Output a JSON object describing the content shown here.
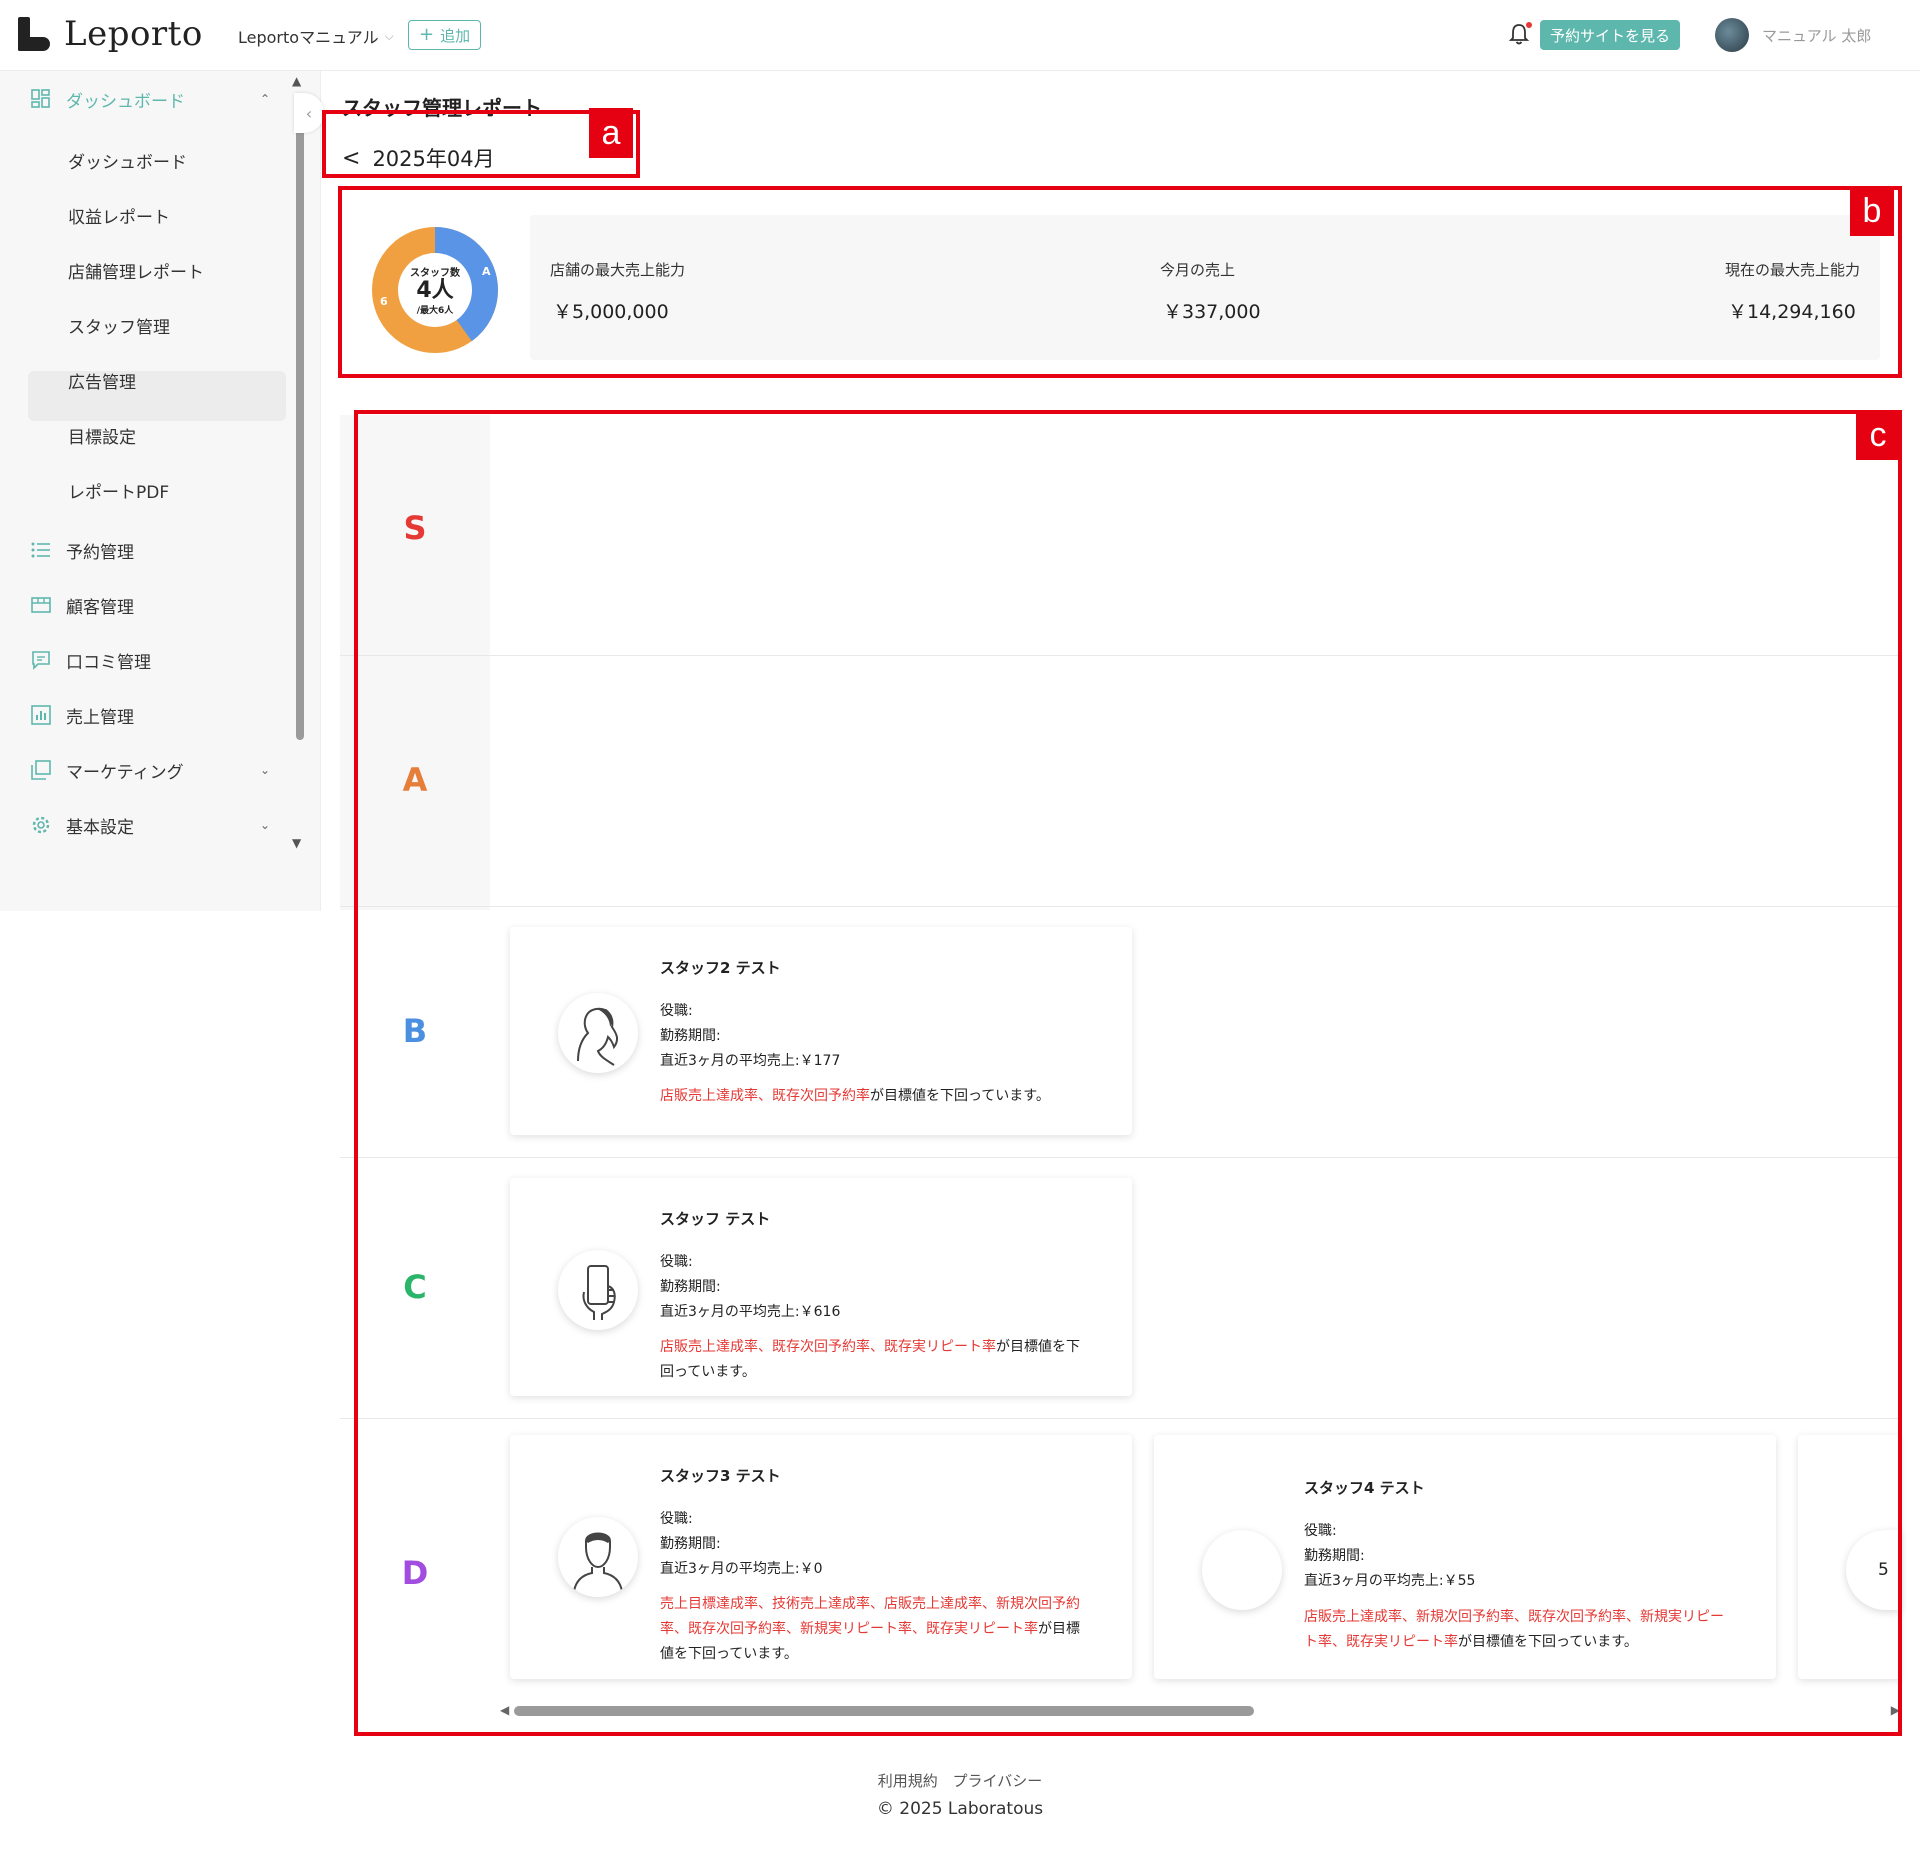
{
  "header": {
    "logo_text": "Leporto",
    "shop_name": "Leportoマニュアル",
    "add_label": "追加",
    "site_button": "予約サイトを見る",
    "user_name": "マニュアル 太郎"
  },
  "sidebar": {
    "dashboard": "ダッシュボード",
    "sub_items": [
      "ダッシュボード",
      "収益レポート",
      "店舗管理レポート",
      "スタッフ管理",
      "広告管理",
      "目標設定",
      "レポートPDF"
    ],
    "items": [
      "予約管理",
      "顧客管理",
      "口コミ管理",
      "売上管理",
      "マーケティング",
      "基本設定"
    ]
  },
  "main": {
    "title": "スタッフ管理レポート",
    "month": "2025年04月"
  },
  "summary": {
    "donut": {
      "top_label": "スタッフ数",
      "count": "4人",
      "max_label": "/最大6人",
      "seg_a_label": "A",
      "seg_b_label": "6",
      "filled_fraction": 0.4
    },
    "stats": [
      {
        "label": "店舗の最大売上能力",
        "value": "￥5,000,000"
      },
      {
        "label": "今月の売上",
        "value": "￥337,000"
      },
      {
        "label": "現在の最大売上能力",
        "value": "￥14,294,160"
      }
    ]
  },
  "ranks": {
    "s": "S",
    "a": "A",
    "b": "B",
    "c": "C",
    "d": "D"
  },
  "staff": {
    "role_label": "役職:",
    "period_label": "勤務期間:",
    "cards": [
      {
        "name": "スタッフ2 テスト",
        "avg": "直近3ヶ月の平均売上:￥177",
        "warn_red": "店販売上達成率、既存次回予約率",
        "warn_tail": "が目標値を下回っています。"
      },
      {
        "name": "スタッフ テスト",
        "avg": "直近3ヶ月の平均売上:￥616",
        "warn_red": "店販売上達成率、既存次回予約率、既存実リピート率",
        "warn_tail": "が目標値を下回っています。"
      },
      {
        "name": "スタッフ3 テスト",
        "avg": "直近3ヶ月の平均売上:￥0",
        "warn_red": "売上目標達成率、技術売上達成率、店販売上達成率、新規次回予約率、既存次回予約率、新規実リピート率、既存実リピート率",
        "warn_tail": "が目標値を下回っています。"
      },
      {
        "name": "スタッフ4 テスト",
        "avg": "直近3ヶ月の平均売上:￥55",
        "warn_red": "店販売上達成率、新規次回予約率、既存次回予約率、新規実リピート率、既存実リピート率",
        "warn_tail": "が目標値を下回っています。"
      }
    ],
    "partial_card_number": "5"
  },
  "annotations": {
    "a": "a",
    "b": "b",
    "c": "c"
  },
  "footer": {
    "terms": "利用規約",
    "privacy": "プライバシー",
    "copyright": "© 2025 Laboratous"
  },
  "colors": {
    "accent": "#5eb7ad",
    "rank_s": "#e53935",
    "rank_a": "#e67e3a",
    "rank_b": "#4a8fe0",
    "rank_c": "#2bb56a",
    "rank_d": "#a34de0",
    "donut_blue": "#5a94e6",
    "donut_orange": "#f0a040",
    "annotation": "#e50012"
  }
}
